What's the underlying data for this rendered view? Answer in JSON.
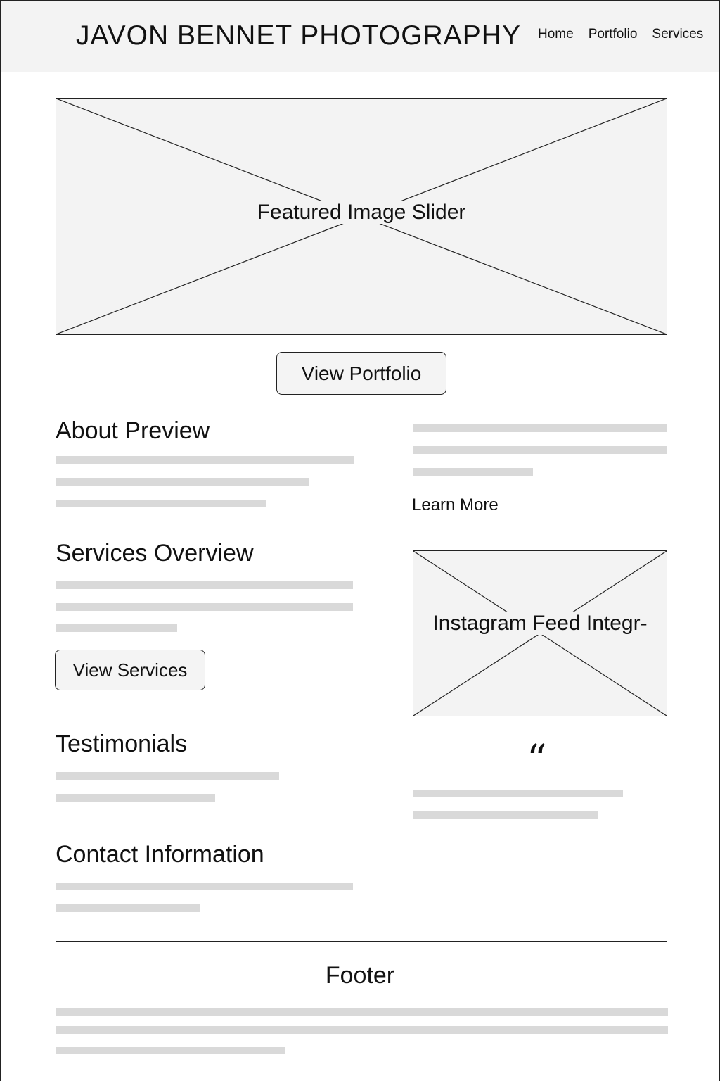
{
  "header": {
    "site_title": "JAVON BENNET PHOTOGRAPHY",
    "nav": [
      {
        "label": "Home"
      },
      {
        "label": "Portfolio"
      },
      {
        "label": "Services"
      }
    ]
  },
  "hero": {
    "label": "Featured Image Slider",
    "button_label": "View Portfolio"
  },
  "about": {
    "heading": "About Preview",
    "link_label": "Learn More"
  },
  "services": {
    "heading": "Services Overview",
    "button_label": "View Services"
  },
  "instagram": {
    "label": "Instagram Feed Integr-"
  },
  "testimonials": {
    "heading": "Testimonials",
    "quote_mark": "“"
  },
  "contact": {
    "heading": "Contact Information"
  },
  "footer": {
    "title": "Footer"
  },
  "colors": {
    "placeholder_fill": "#f3f3f3",
    "text_line": "#d9d9d9",
    "stroke": "#222222"
  }
}
